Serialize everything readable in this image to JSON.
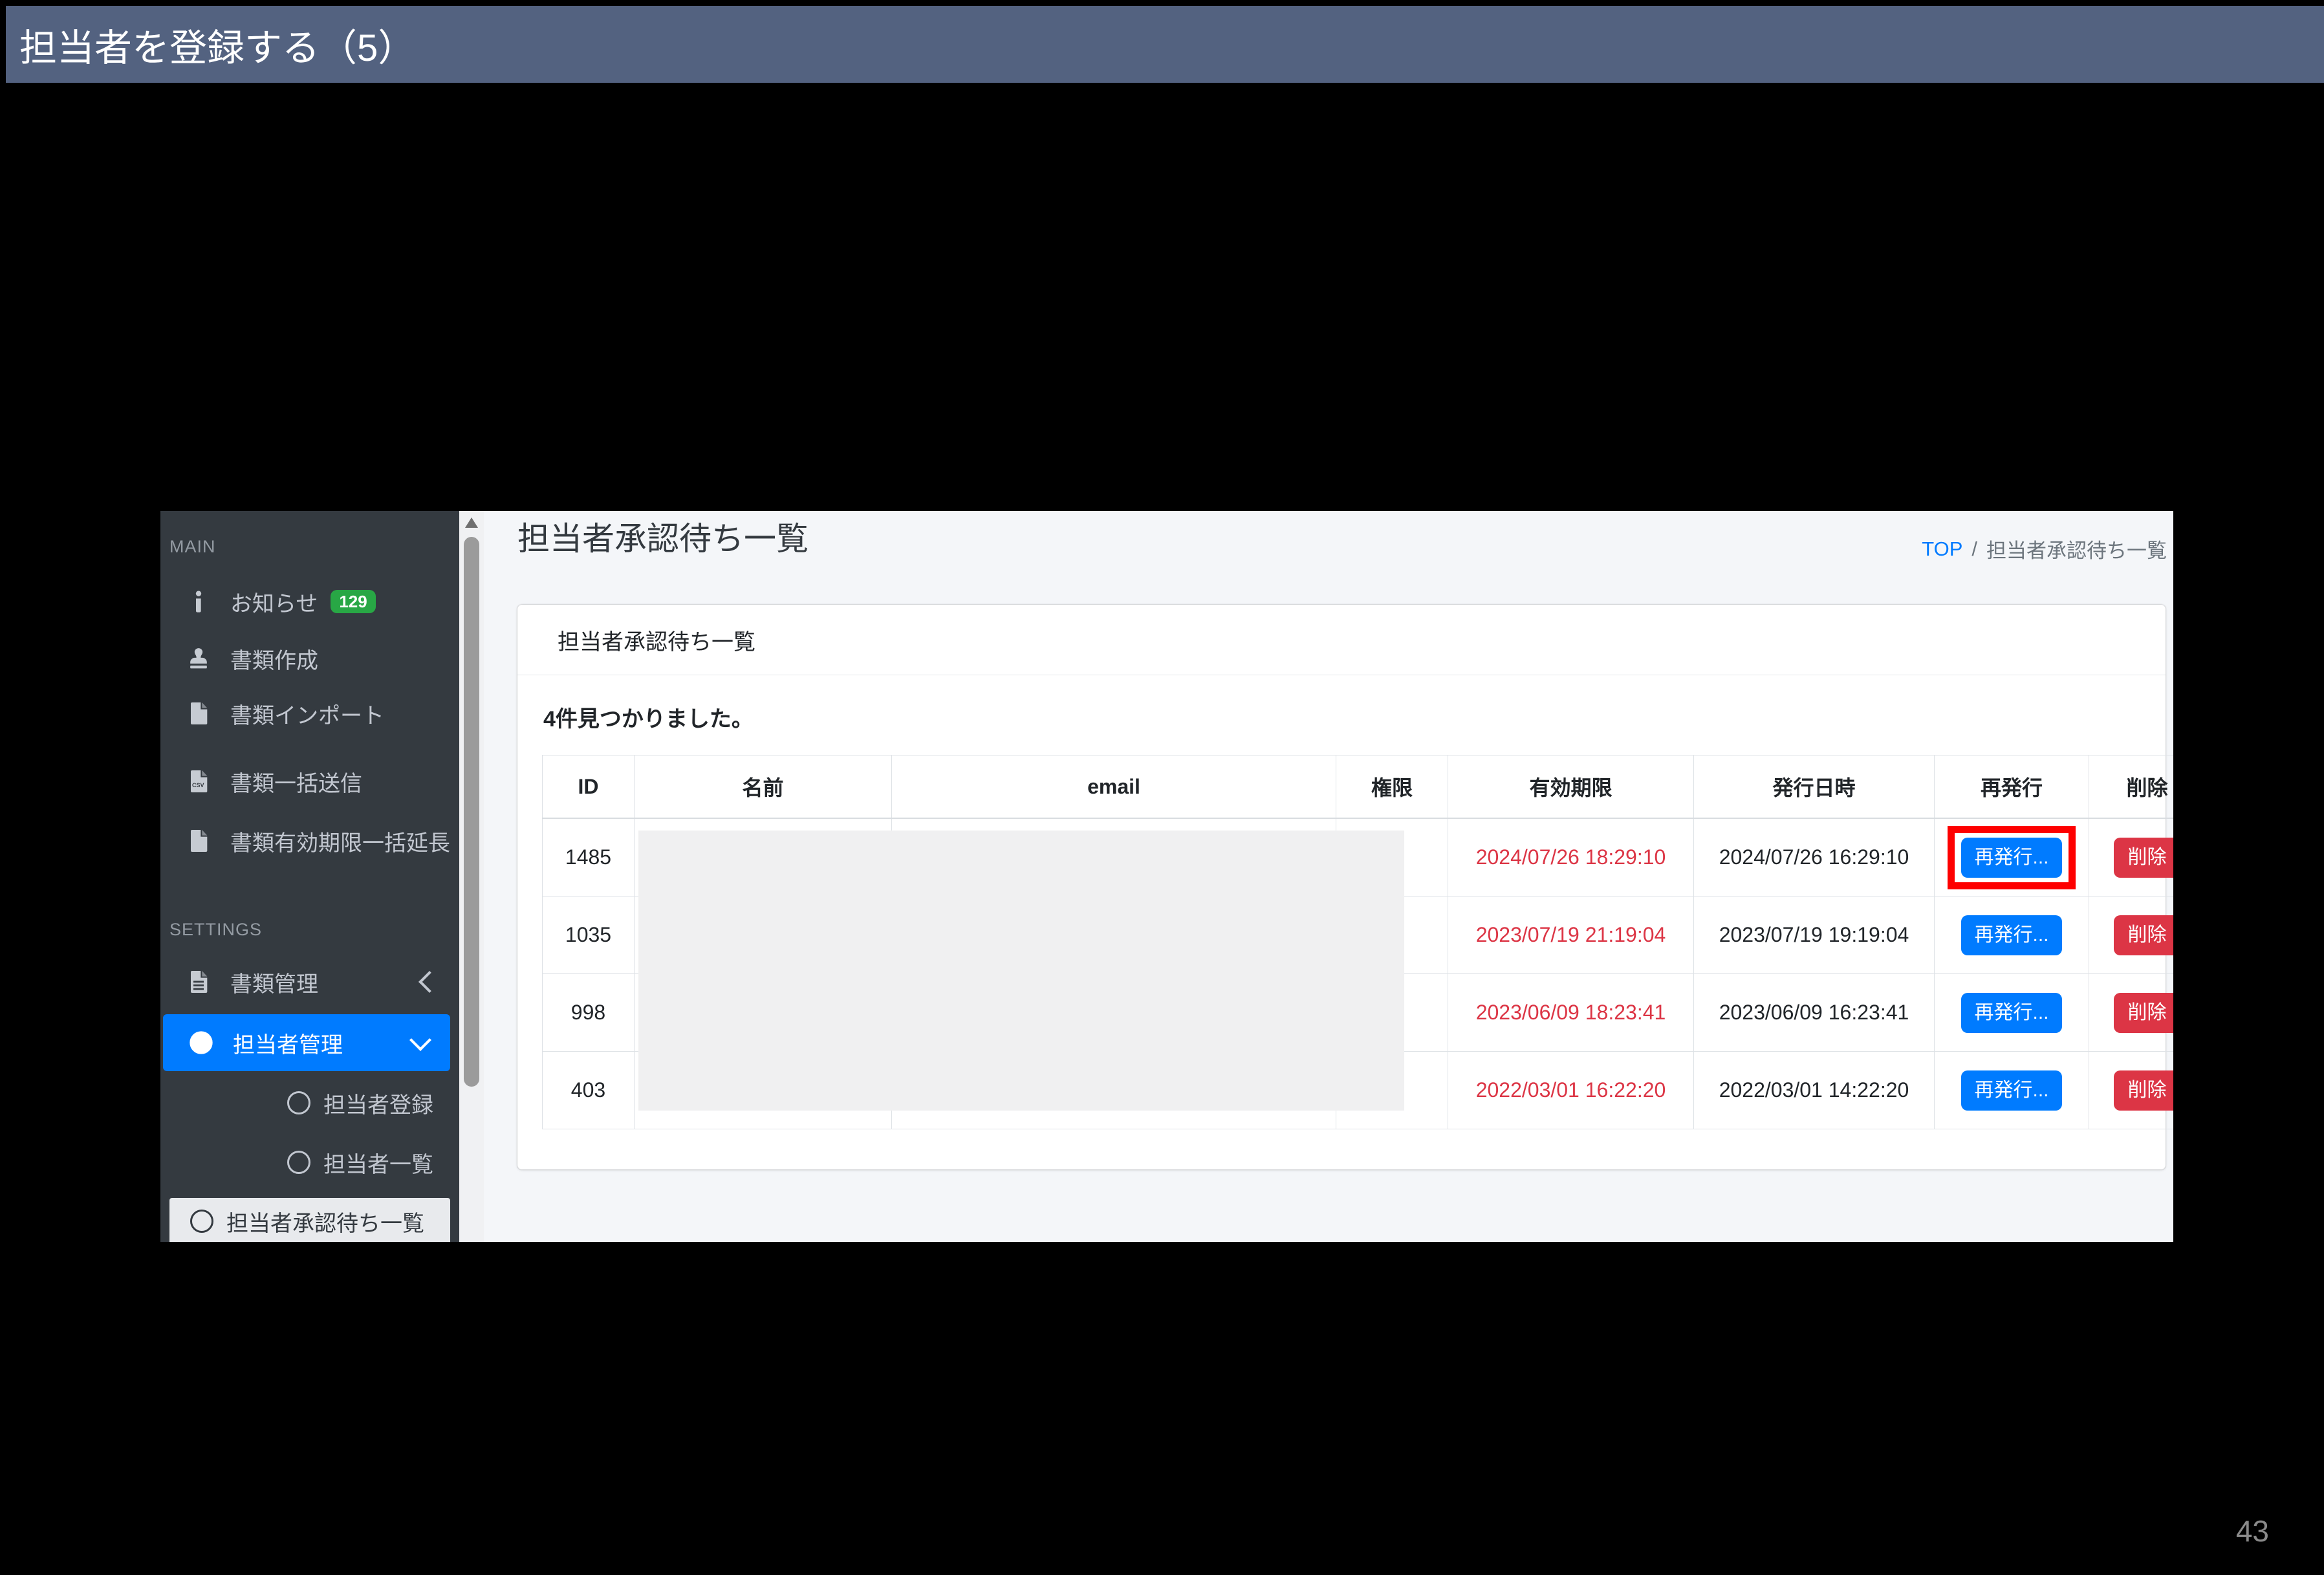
{
  "slide": {
    "title": "担当者を登録する（5）",
    "page_number": "43"
  },
  "colors": {
    "title_bar": "#536280",
    "sidebar_bg": "#343a40",
    "primary_blue": "#007bff",
    "danger_red": "#dc3545",
    "badge_green": "#28a745",
    "expiry_text": "#dc3545",
    "annotation_red": "#fe0000",
    "page_bg": "#f4f6f9"
  },
  "sidebar": {
    "sections": [
      {
        "label": "MAIN",
        "items": [
          {
            "icon": "info-icon",
            "label": "お知らせ",
            "badge": "129"
          },
          {
            "icon": "stamp-icon",
            "label": "書類作成"
          },
          {
            "icon": "file-icon",
            "label": "書類インポート"
          },
          {
            "icon": "csv-file-icon",
            "label": "書類一括送信"
          },
          {
            "icon": "file-icon",
            "label": "書類有効期限一括延長"
          }
        ]
      },
      {
        "label": "SETTINGS",
        "items": [
          {
            "icon": "file-lines-icon",
            "label": "書類管理",
            "chevron": "left"
          },
          {
            "icon": "user-circle-icon",
            "label": "担当者管理",
            "chevron": "down",
            "active": true
          },
          {
            "icon": "circle-icon",
            "label": "担当者登録",
            "sub": true
          },
          {
            "icon": "circle-icon",
            "label": "担当者一覧",
            "sub": true
          },
          {
            "icon": "circle-icon",
            "label": "担当者承認待ち一覧",
            "sub": true,
            "active": true
          }
        ]
      }
    ]
  },
  "main": {
    "page_title": "担当者承認待ち一覧",
    "breadcrumb": {
      "link": "TOP",
      "separator": "/",
      "current": "担当者承認待ち一覧"
    },
    "card": {
      "title": "担当者承認待ち一覧",
      "result_count": "4件見つかりました。",
      "table": {
        "headers": [
          "ID",
          "名前",
          "email",
          "権限",
          "有効期限",
          "発行日時",
          "再発行",
          "削除"
        ],
        "rows": [
          {
            "id": "1485",
            "name": "",
            "email": "",
            "permission": "",
            "expiry": "2024/07/26 18:29:10",
            "issued": "2024/07/26 16:29:10",
            "reissue_label": "再発行...",
            "delete_label": "削除",
            "highlighted": true
          },
          {
            "id": "1035",
            "name": "",
            "email": "",
            "permission": "",
            "expiry": "2023/07/19 21:19:04",
            "issued": "2023/07/19 19:19:04",
            "reissue_label": "再発行...",
            "delete_label": "削除",
            "highlighted": false
          },
          {
            "id": "998",
            "name": "",
            "email": "",
            "permission": "",
            "expiry": "2023/06/09 18:23:41",
            "issued": "2023/06/09 16:23:41",
            "reissue_label": "再発行...",
            "delete_label": "削除",
            "highlighted": false
          },
          {
            "id": "403",
            "name": "",
            "email": "",
            "permission": "",
            "expiry": "2022/03/01 16:22:20",
            "issued": "2022/03/01 14:22:20",
            "reissue_label": "再発行...",
            "delete_label": "削除",
            "highlighted": false
          }
        ]
      }
    }
  }
}
